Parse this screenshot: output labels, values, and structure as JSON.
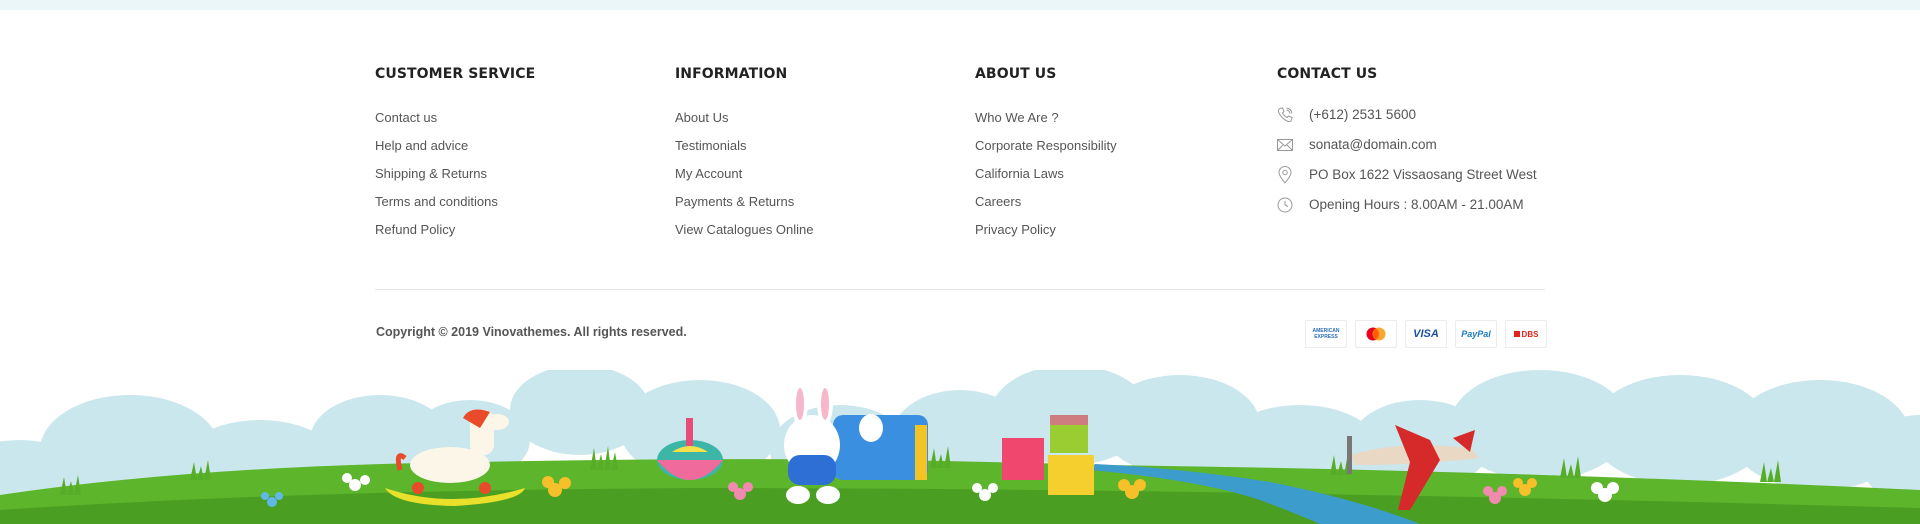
{
  "columns": [
    {
      "title": "CUSTOMER SERVICE",
      "links": [
        "Contact us",
        "Help and advice",
        "Shipping & Returns",
        "Terms and conditions",
        "Refund Policy"
      ]
    },
    {
      "title": "INFORMATION",
      "links": [
        "About Us",
        "Testimonials",
        "My Account",
        "Payments & Returns",
        "View Catalogues Online"
      ]
    },
    {
      "title": "ABOUT US",
      "links": [
        "Who We Are ?",
        "Corporate Responsibility",
        "California Laws",
        "Careers",
        "Privacy Policy"
      ]
    }
  ],
  "contact": {
    "title": "CONTACT US",
    "items": [
      {
        "icon": "phone-icon",
        "text": "(+612) 2531 5600"
      },
      {
        "icon": "mail-icon",
        "text": "sonata@domain.com"
      },
      {
        "icon": "location-pin-icon",
        "text": "PO Box 1622 Vissaosang Street West"
      },
      {
        "icon": "clock-icon",
        "text": "Opening Hours : 8.00AM - 21.00AM"
      }
    ]
  },
  "copyright": "Copyright © 2019 Vinovathemes. All rights reserved.",
  "payments": [
    {
      "name": "american-express",
      "label": "AMERICAN EXPRESS",
      "color": "#2a6ebb"
    },
    {
      "name": "mastercard",
      "label": "",
      "color": "#eb001b"
    },
    {
      "name": "visa",
      "label": "VISA",
      "color": "#1a4fa0"
    },
    {
      "name": "paypal",
      "label": "PayPal",
      "color": "#1d7cc1"
    },
    {
      "name": "dbs",
      "label": "DBS",
      "color": "#e2231a"
    }
  ],
  "colors": {
    "sky": "#cbe7ee",
    "grass": "#5db52b",
    "grass_dark": "#4a9e22",
    "river": "#3c9ccc",
    "top_band": "#eaf6f7"
  }
}
